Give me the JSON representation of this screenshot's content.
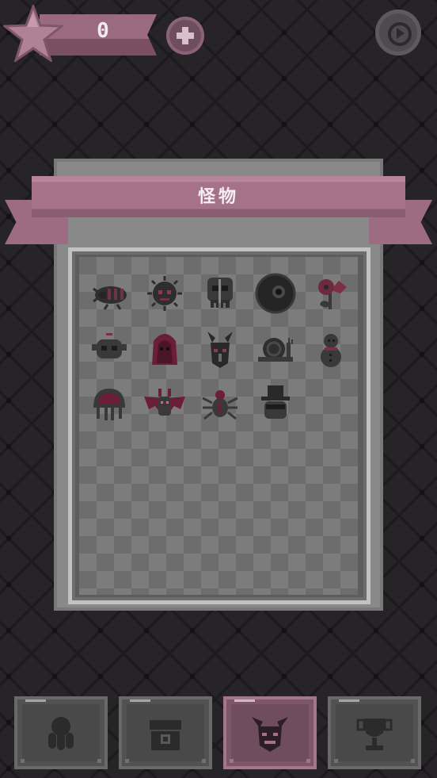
{
  "top_bar": {
    "score": "0",
    "star_icon": "star-icon",
    "add_icon": "plus-icon",
    "sound_icon": "sound-icon"
  },
  "panel": {
    "title": "怪物"
  },
  "monsters": [
    {
      "name": "beetle-icon"
    },
    {
      "name": "germ-icon"
    },
    {
      "name": "skull-mask-icon"
    },
    {
      "name": "eyeball-icon"
    },
    {
      "name": "carnivorous-plant-icon"
    },
    {
      "name": "skull-pot-icon"
    },
    {
      "name": "hooded-ghost-icon"
    },
    {
      "name": "horned-demon-icon"
    },
    {
      "name": "snail-icon"
    },
    {
      "name": "snowman-icon"
    },
    {
      "name": "brain-jellyfish-icon"
    },
    {
      "name": "bat-icon"
    },
    {
      "name": "spider-icon"
    },
    {
      "name": "top-hat-icon"
    }
  ],
  "tabs": [
    {
      "name": "tab-characters",
      "icon": "octopus-icon",
      "active": false
    },
    {
      "name": "tab-shop",
      "icon": "chest-icon",
      "active": false
    },
    {
      "name": "tab-monsters",
      "icon": "demon-head-icon",
      "active": true
    },
    {
      "name": "tab-trophies",
      "icon": "trophy-icon",
      "active": false
    }
  ],
  "colors": {
    "accent": "#a5728a",
    "background": "#262426",
    "panel": "#8a898a"
  }
}
